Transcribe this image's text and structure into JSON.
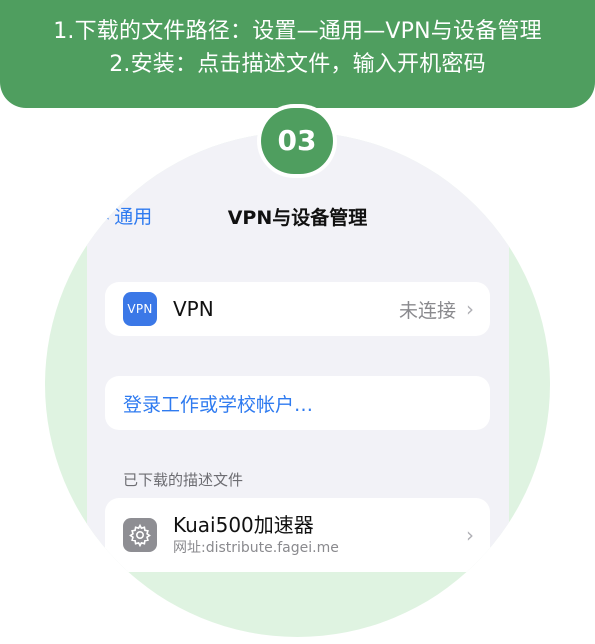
{
  "banner": {
    "line1": "1.下载的文件路径：设置—通用—VPN与设备管理",
    "line2": "2.安装：点击描述文件，输入开机密码"
  },
  "step": {
    "number": "03"
  },
  "nav": {
    "back_label": "通用",
    "title": "VPN与设备管理"
  },
  "vpn": {
    "icon_text": "VPN",
    "label": "VPN",
    "status": "未连接"
  },
  "login": {
    "label": "登录工作或学校帐户…"
  },
  "downloaded": {
    "header": "已下载的描述文件",
    "profile_name": "Kuai500加速器",
    "profile_url": "网址:distribute.fagei.me"
  },
  "colors": {
    "accent_green": "#4f9e5f",
    "circle_bg": "#dff3e1",
    "ios_blue": "#2f7bf0",
    "vpn_icon_blue": "#3b78e7"
  },
  "icons": {
    "back": "chevron-left-icon",
    "row_chevron": "chevron-right-icon",
    "settings": "gear-icon"
  }
}
